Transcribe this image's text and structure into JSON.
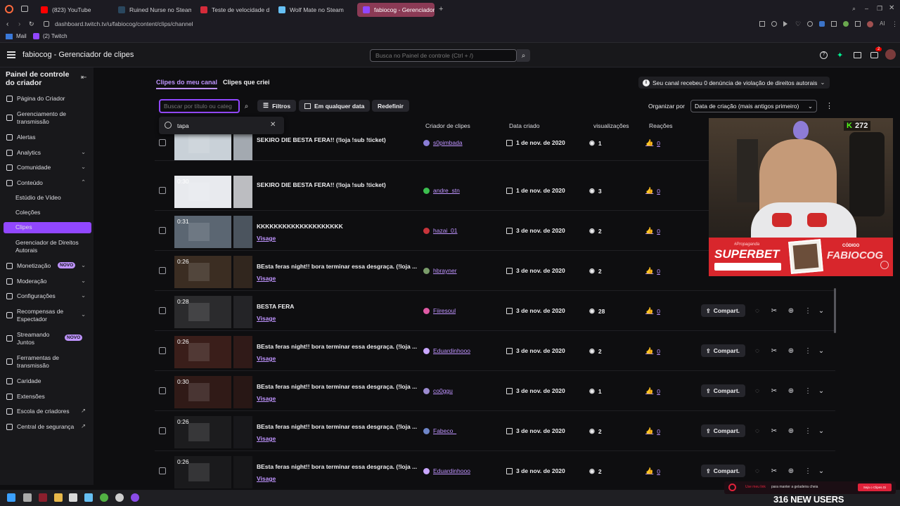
{
  "browser": {
    "tabs": [
      {
        "label": "(823) YouTube",
        "color": "#ff0000"
      },
      {
        "label": "Ruined Nurse no Steam",
        "color": "#2a475e"
      },
      {
        "label": "Teste de velocidade da in",
        "color": "#d52b3a"
      },
      {
        "label": "Wolf Mate no Steam",
        "color": "#66c0f4"
      },
      {
        "label": "fabiocog - Gerenciador de",
        "color": "#9146ff"
      }
    ],
    "url": "dashboard.twitch.tv/u/fabiocog/content/clips/channel",
    "bookmarks": [
      {
        "label": "Mail"
      },
      {
        "label": "(2) Twitch"
      }
    ]
  },
  "topnav": {
    "title": "fabiocog - Gerenciador de clipes",
    "search_placeholder": "Busca no Painel de controle (Ctrl + /)",
    "notif_count": "2"
  },
  "sidebar": {
    "header": "Painel de controle do criador",
    "items": [
      {
        "label": "Página do Criador",
        "icon": "home-icon"
      },
      {
        "label": "Gerenciamento de transmissão",
        "icon": "broadcast-icon"
      },
      {
        "label": "Alertas",
        "icon": "alert-icon"
      },
      {
        "label": "Analytics",
        "icon": "chart-icon",
        "chevron": "down"
      },
      {
        "label": "Comunidade",
        "icon": "community-icon",
        "chevron": "down"
      },
      {
        "label": "Conteúdo",
        "icon": "content-icon",
        "chevron": "up"
      },
      {
        "label": "Estúdio de Vídeo",
        "sub": true
      },
      {
        "label": "Coleções",
        "sub": true
      },
      {
        "label": "Clipes",
        "sub": true,
        "active": true
      },
      {
        "label": "Gerenciador de Direitos Autorais",
        "sub": true
      },
      {
        "label": "Monetização",
        "icon": "money-icon",
        "badge": "NOVO",
        "chevron": "down"
      },
      {
        "label": "Moderação",
        "icon": "shield-icon",
        "chevron": "down"
      },
      {
        "label": "Configurações",
        "icon": "gear-icon",
        "chevron": "down"
      },
      {
        "label": "Recompensas de Espectador",
        "icon": "reward-icon",
        "chevron": "down"
      },
      {
        "label": "Streamando Juntos",
        "icon": "together-icon",
        "badge": "NOVO"
      },
      {
        "label": "Ferramentas de transmissão",
        "icon": "tools-icon"
      },
      {
        "label": "Caridade",
        "icon": "charity-icon"
      },
      {
        "label": "Extensões",
        "icon": "extension-icon"
      },
      {
        "label": "Escola de criadores",
        "icon": "school-icon",
        "external": true
      },
      {
        "label": "Central de segurança",
        "icon": "safety-icon",
        "external": true
      }
    ]
  },
  "clips_page": {
    "tab_mine": "Clipes do meu canal",
    "tab_created": "Clipes que criei",
    "copyright_notice": "Seu canal recebeu 0 denúncia de violação de direitos autorais",
    "search_placeholder": "Buscar por título ou categ",
    "filters_label": "Filtros",
    "date_filter_label": "Em qualquer data",
    "reset_label": "Redefinir",
    "sort_label": "Organizar por",
    "sort_value": "Data de criação (mais antigos primeiro)",
    "recent_search": "tapa",
    "columns": {
      "creator": "Criador de clipes",
      "date": "Data criado",
      "views": "visualizações",
      "reactions": "Reações"
    },
    "share_label": "Compart."
  },
  "clips": [
    {
      "duration": "",
      "title": "SEKIRO DIE BESTA FERA!! (!loja !sub !ticket)",
      "game": "",
      "creator": "s0pimbada",
      "date": "1 de nov. de 2020",
      "views": "1",
      "reactions": "0",
      "thumb": "#c9d1d8",
      "avatar": "#8a7dd6"
    },
    {
      "duration": "0:30",
      "title": "SEKIRO DIE BESTA FERA!! (!loja !sub !ticket)",
      "game": "",
      "creator": "andre_stn",
      "date": "1 de nov. de 2020",
      "views": "3",
      "reactions": "0",
      "thumb": "#e8eaee",
      "avatar": "#3cbf4f"
    },
    {
      "duration": "0:31",
      "title": "KKKKKKKKKKKKKKKKKKKK",
      "game": "Visage",
      "creator": "hazai_01",
      "date": "3 de nov. de 2020",
      "views": "2",
      "reactions": "0",
      "thumb": "#5b6672",
      "avatar": "#c8343b"
    },
    {
      "duration": "0:26",
      "title": "BEsta feras night!! bora terminar essa desgraça. (!loja ...",
      "game": "Visage",
      "creator": "hbrayner",
      "date": "3 de nov. de 2020",
      "views": "2",
      "reactions": "0",
      "thumb": "#3b2d22",
      "avatar": "#7a9c6a"
    },
    {
      "duration": "0:28",
      "title": "BESTA FERA",
      "game": "Visage",
      "creator": "Fiiresoul",
      "date": "3 de nov. de 2020",
      "views": "28",
      "reactions": "0",
      "thumb": "#2b2b2d",
      "avatar": "#e05aa5"
    },
    {
      "duration": "0:26",
      "title": "BEsta feras night!! bora terminar essa desgraça. (!loja ...",
      "game": "Visage",
      "creator": "Eduardinhooo",
      "date": "3 de nov. de 2020",
      "views": "2",
      "reactions": "0",
      "thumb": "#3a1e1a",
      "avatar": "#c9a7ff"
    },
    {
      "duration": "0:30",
      "title": "BEsta feras night!! bora terminar essa desgraça. (!loja ...",
      "game": "Visage",
      "creator": "co0ggu",
      "date": "3 de nov. de 2020",
      "views": "1",
      "reactions": "0",
      "thumb": "#301a17",
      "avatar": "#9c8bd0"
    },
    {
      "duration": "0:26",
      "title": "BEsta feras night!! bora terminar essa desgraça. (!loja ...",
      "game": "Visage",
      "creator": "Fabeco_",
      "date": "3 de nov. de 2020",
      "views": "2",
      "reactions": "0",
      "thumb": "#1c1c1e",
      "avatar": "#6f86c9"
    },
    {
      "duration": "0:26",
      "title": "BEsta feras night!! bora terminar essa desgraça. (!loja ...",
      "game": "Visage",
      "creator": "Eduardinhooo",
      "date": "3 de nov. de 2020",
      "views": "2",
      "reactions": "0",
      "thumb": "#1a1a1c",
      "avatar": "#c9a7ff"
    }
  ],
  "overlay": {
    "viewer_count": "272",
    "sponsor": "SUPERBET",
    "sponsor_tag": "#Propaganda",
    "code_label": "CÓDIGO",
    "code": "FABIOCOG",
    "new_users": "316 NEW USERS",
    "ticker": "Use meu link",
    "ticker_rest": "para manter a geladeira cheia",
    "ticker_btn": "Seja o Clipes.Gi"
  }
}
